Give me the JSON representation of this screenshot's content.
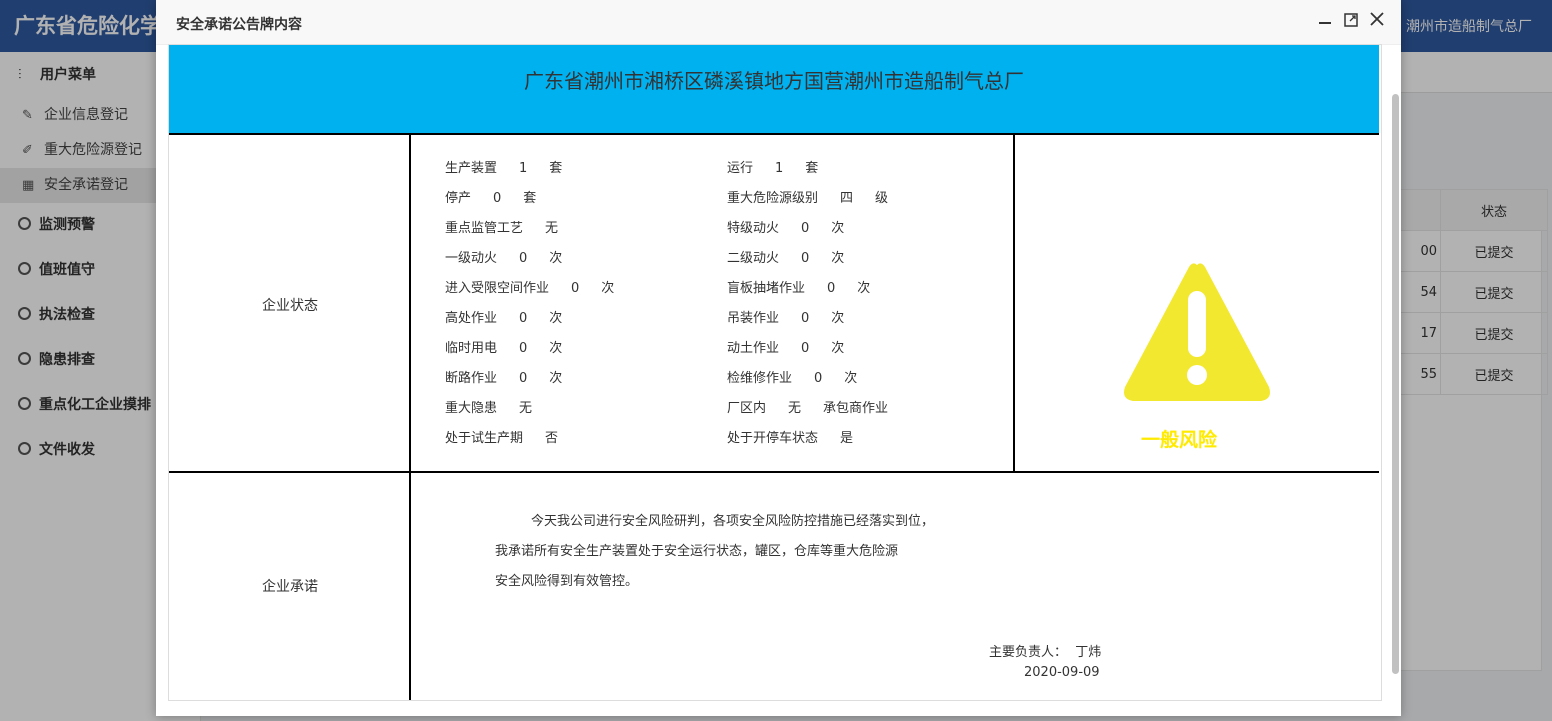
{
  "app": {
    "title": "广东省危险化学",
    "company": "潮州市造船制气总厂"
  },
  "sidebar": {
    "menu_title": "用户菜单",
    "sub_items": [
      {
        "label": "企业信息登记",
        "icon": "pencil-icon"
      },
      {
        "label": "重大危险源登记",
        "icon": "edit-icon"
      },
      {
        "label": "安全承诺登记",
        "icon": "list-icon"
      }
    ],
    "groups": [
      {
        "label": "监测预警"
      },
      {
        "label": "值班值守"
      },
      {
        "label": "执法检查"
      },
      {
        "label": "隐患排查"
      },
      {
        "label": "重点化工企业摸排"
      },
      {
        "label": "文件收发"
      }
    ]
  },
  "bg_table": {
    "header_status": "状态",
    "rows": [
      {
        "tail": "00",
        "status": "已提交"
      },
      {
        "tail": "54",
        "status": "已提交"
      },
      {
        "tail": "17",
        "status": "已提交"
      },
      {
        "tail": "55",
        "status": "已提交"
      }
    ]
  },
  "modal": {
    "title": "安全承诺公告牌内容",
    "banner": "广东省潮州市湘桥区磷溪镇地方国营潮州市造船制气总厂",
    "status_label": "企业状态",
    "commit_label": "企业承诺",
    "left_stats": [
      {
        "name": "生产装置",
        "value": "1",
        "unit": "套"
      },
      {
        "name": "停产",
        "value": "0",
        "unit": "套"
      },
      {
        "name": "重点监管工艺",
        "value": "无",
        "unit": ""
      },
      {
        "name": "一级动火",
        "value": "0",
        "unit": "次"
      },
      {
        "name": "进入受限空间作业",
        "value": "0",
        "unit": "次"
      },
      {
        "name": "高处作业",
        "value": "0",
        "unit": "次"
      },
      {
        "name": "临时用电",
        "value": "0",
        "unit": "次"
      },
      {
        "name": "断路作业",
        "value": "0",
        "unit": "次"
      },
      {
        "name": "重大隐患",
        "value": "无",
        "unit": ""
      },
      {
        "name": "处于试生产期",
        "value": "否",
        "unit": ""
      }
    ],
    "right_stats": [
      {
        "name": "运行",
        "value": "1",
        "unit": "套"
      },
      {
        "name": "重大危险源级别",
        "value": "四",
        "unit": "级"
      },
      {
        "name": "特级动火",
        "value": "0",
        "unit": "次"
      },
      {
        "name": "二级动火",
        "value": "0",
        "unit": "次"
      },
      {
        "name": "盲板抽堵作业",
        "value": "0",
        "unit": "次"
      },
      {
        "name": "吊装作业",
        "value": "0",
        "unit": "次"
      },
      {
        "name": "动土作业",
        "value": "0",
        "unit": "次"
      },
      {
        "name": "检维修作业",
        "value": "0",
        "unit": "次"
      },
      {
        "name": "厂区内",
        "value": "无",
        "unit": "承包商作业"
      },
      {
        "name": "处于开停车状态",
        "value": "是",
        "unit": ""
      }
    ],
    "risk_label": "一般风险",
    "risk_color": "#f2e830",
    "commitment": [
      "今天我公司进行安全风险研判，各项安全风险防控措施已经落实到位，",
      "我承诺所有安全生产装置处于安全运行状态，罐区，仓库等重大危险源",
      "安全风险得到有效管控。"
    ],
    "signer_label": "主要负责人：",
    "signer_name": "丁炜",
    "date": "2020-09-09"
  }
}
